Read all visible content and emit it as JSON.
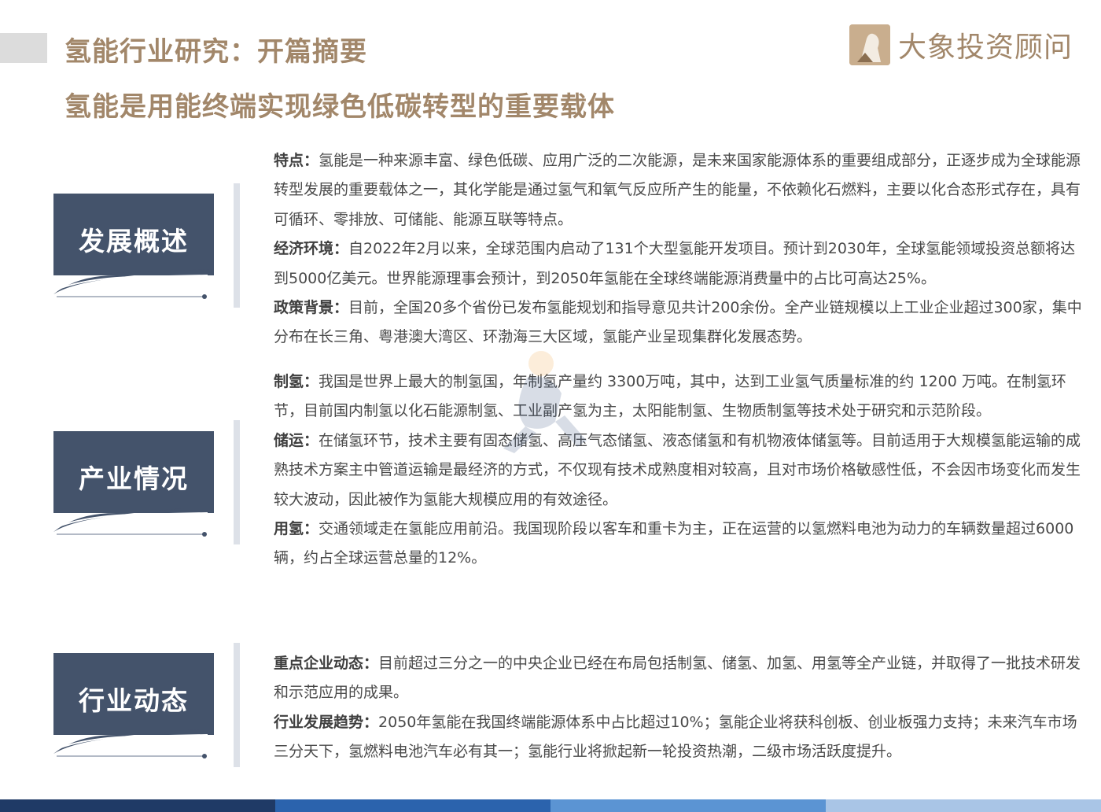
{
  "header": {
    "title": "氢能行业研究：开篇摘要",
    "subtitle": "氢能是用能终端实现绿色低碳转型的重要载体",
    "logo_text": "大象投资顾问"
  },
  "sections": [
    {
      "title": "发展概述",
      "paragraphs": [
        {
          "label": "特点：",
          "text": "氢能是一种来源丰富、绿色低碳、应用广泛的二次能源，是未来国家能源体系的重要组成部分，正逐步成为全球能源转型发展的重要载体之一，其化学能是通过氢气和氧气反应所产生的能量，不依赖化石燃料，主要以化合态形式存在，具有可循环、零排放、可储能、能源互联等特点。"
        },
        {
          "label": "经济环境：",
          "text": "自2022年2月以来，全球范围内启动了131个大型氢能开发项目。预计到2030年，全球氢能领域投资总额将达到5000亿美元。世界能源理事会预计，到2050年氢能在全球终端能源消费量中的占比可高达25%。"
        },
        {
          "label": "政策背景：",
          "text": "目前，全国20多个省份已发布氢能规划和指导意见共计200余份。全产业链规模以上工业企业超过300家，集中分布在长三角、粤港澳大湾区、环渤海三大区域，氢能产业呈现集群化发展态势。"
        }
      ]
    },
    {
      "title": "产业情况",
      "paragraphs": [
        {
          "label": "制氢：",
          "text": "我国是世界上最大的制氢国，年制氢产量约 3300万吨，其中，达到工业氢气质量标准的约 1200 万吨。在制氢环节，目前国内制氢以化石能源制氢、工业副产氢为主，太阳能制氢、生物质制氢等技术处于研究和示范阶段。"
        },
        {
          "label": "储运：",
          "text": "在储氢环节，技术主要有固态储氢、高压气态储氢、液态储氢和有机物液体储氢等。目前适用于大规模氢能运输的成熟技术方案主中管道运输是最经济的方式，不仅现有技术成熟度相对较高，且对市场价格敏感性低，不会因市场变化而发生较大波动，因此被作为氢能大规模应用的有效途径。"
        },
        {
          "label": "用氢：",
          "text": "交通领域走在氢能应用前沿。我国现阶段以客车和重卡为主，正在运营的以氢燃料电池为动力的车辆数量超过6000辆，约占全球运营总量的12%。"
        }
      ]
    },
    {
      "title": "行业动态",
      "paragraphs": [
        {
          "label": "重点企业动态：",
          "text": "目前超过三分之一的中央企业已经在布局包括制氢、储氢、加氢、用氢等全产业链，并取得了一批技术研发和示范应用的成果。"
        },
        {
          "label": "行业发展趋势：",
          "text": "2050年氢能在我国终端能源体系中占比超过10%；氢能企业将获科创板、创业板强力支持；未来汽车市场三分天下，氢燃料电池汽车必有其一；氢能行业将掀起新一轮投资热潮，二级市场活跃度提升。"
        }
      ]
    }
  ],
  "colors": {
    "accent": "#a2876a",
    "card": "#44536b",
    "footer": [
      "#1f3a66",
      "#2b63ad",
      "#5b94d3",
      "#a9c5e6"
    ]
  }
}
